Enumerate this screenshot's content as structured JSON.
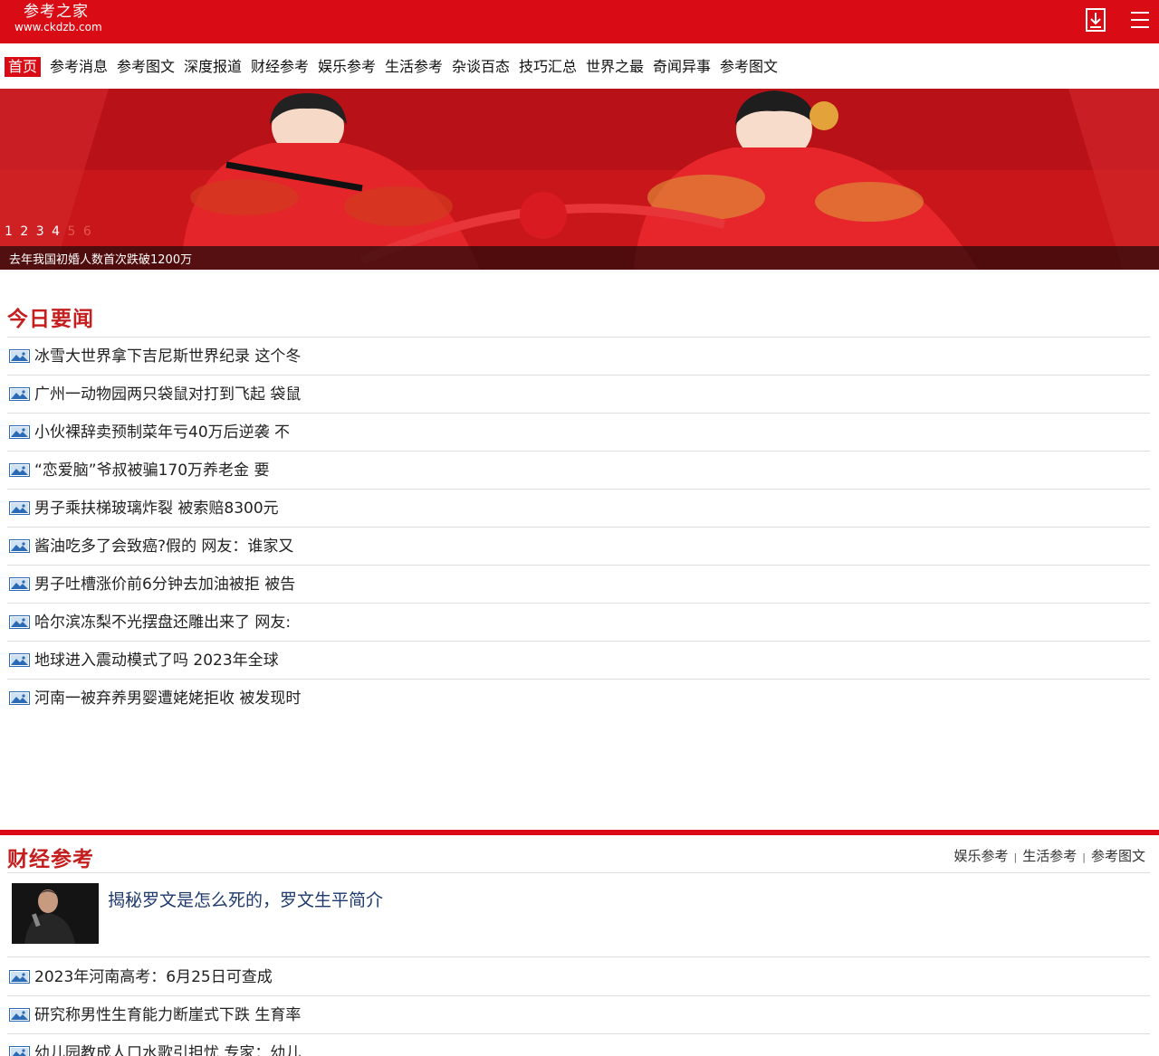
{
  "header": {
    "logo_name": "参考之家",
    "logo_url": "www.ckdzb.com",
    "brand_color": "#d90c15",
    "download_icon": "download-icon",
    "menu_icon": "hamburger-menu-icon"
  },
  "nav": {
    "items": [
      {
        "label": "首页",
        "active": true
      },
      {
        "label": "参考消息"
      },
      {
        "label": "参考图文"
      },
      {
        "label": "深度报道"
      },
      {
        "label": "财经参考"
      },
      {
        "label": "娱乐参考"
      },
      {
        "label": "生活参考"
      },
      {
        "label": "杂谈百态"
      },
      {
        "label": "技巧汇总"
      },
      {
        "label": "世界之最"
      },
      {
        "label": "奇闻异事"
      },
      {
        "label": "参考图文"
      }
    ]
  },
  "banner": {
    "slides": [
      "1",
      "2",
      "3",
      "4",
      "5",
      "6"
    ],
    "current_caption": "去年我国初婚人数首次跌破1200万"
  },
  "today": {
    "title": "今日要闻",
    "items": [
      "冰雪大世界拿下吉尼斯世界纪录 这个冬",
      "广州一动物园两只袋鼠对打到飞起 袋鼠",
      "小伙裸辞卖预制菜年亏40万后逆袭 不",
      "“恋爱脑”爷叔被骗170万养老金 要",
      "男子乘扶梯玻璃炸裂 被索赔8300元",
      "酱油吃多了会致癌?假的 网友：谁家又",
      "男子吐槽涨价前6分钟去加油被拒 被告",
      "哈尔滨冻梨不光摆盘还雕出来了 网友:",
      "地球进入震动模式了吗 2023年全球",
      "河南一被弃养男婴遭姥姥拒收 被发现时"
    ]
  },
  "finance": {
    "title": "财经参考",
    "more_links": [
      "娱乐参考",
      "生活参考",
      "参考图文"
    ],
    "feature_title": "揭秘罗文是怎么死的，罗文生平简介",
    "items": [
      "2023年河南高考：6月25日可查成",
      "研究称男性生育能力断崖式下跌 生育率",
      "幼儿园教成人口水歌引担忧 专家：幼儿"
    ]
  }
}
